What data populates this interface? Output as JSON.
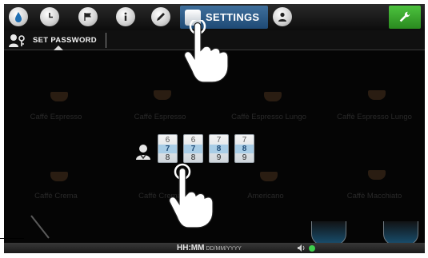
{
  "tabs": [
    {
      "name": "water-drop-tab",
      "icon": "water-drop-icon"
    },
    {
      "name": "clock-tab",
      "icon": "clock-icon"
    },
    {
      "name": "flag-tab",
      "icon": "flag-icon"
    },
    {
      "name": "info-tab",
      "icon": "info-icon"
    },
    {
      "name": "pencil-tab",
      "icon": "pencil-icon"
    }
  ],
  "settings_tab": {
    "label": "SETTINGS",
    "icon": "settings-icon"
  },
  "user_tab": {
    "icon": "user-icon"
  },
  "service_button": {
    "icon": "wrench-icon",
    "color": "#3aab2c"
  },
  "subheader": {
    "label": "SET PASSWORD",
    "icon": "password-key-icon"
  },
  "drinks_row1": [
    "Caffè Espresso",
    "Caffè Espresso",
    "Caffè Espresso Lungo",
    "Caffè Espresso Lungo"
  ],
  "drinks_row2": [
    "Caffè Crema",
    "Caffè Crema",
    "Americano",
    "Caffè Macchiato"
  ],
  "password_wheels": [
    {
      "above": "6",
      "value": "7",
      "below": "8"
    },
    {
      "above": "6",
      "value": "7",
      "below": "8"
    },
    {
      "above": "7",
      "value": "8",
      "below": "9"
    },
    {
      "above": "7",
      "value": "8",
      "below": "9"
    }
  ],
  "status": {
    "time_format": "HH:MM",
    "date_format": "DD/MM/YYYY",
    "volume_icon": "volume-icon",
    "status_dot_color": "#3fcf4d"
  },
  "accent": "#2a5a86"
}
